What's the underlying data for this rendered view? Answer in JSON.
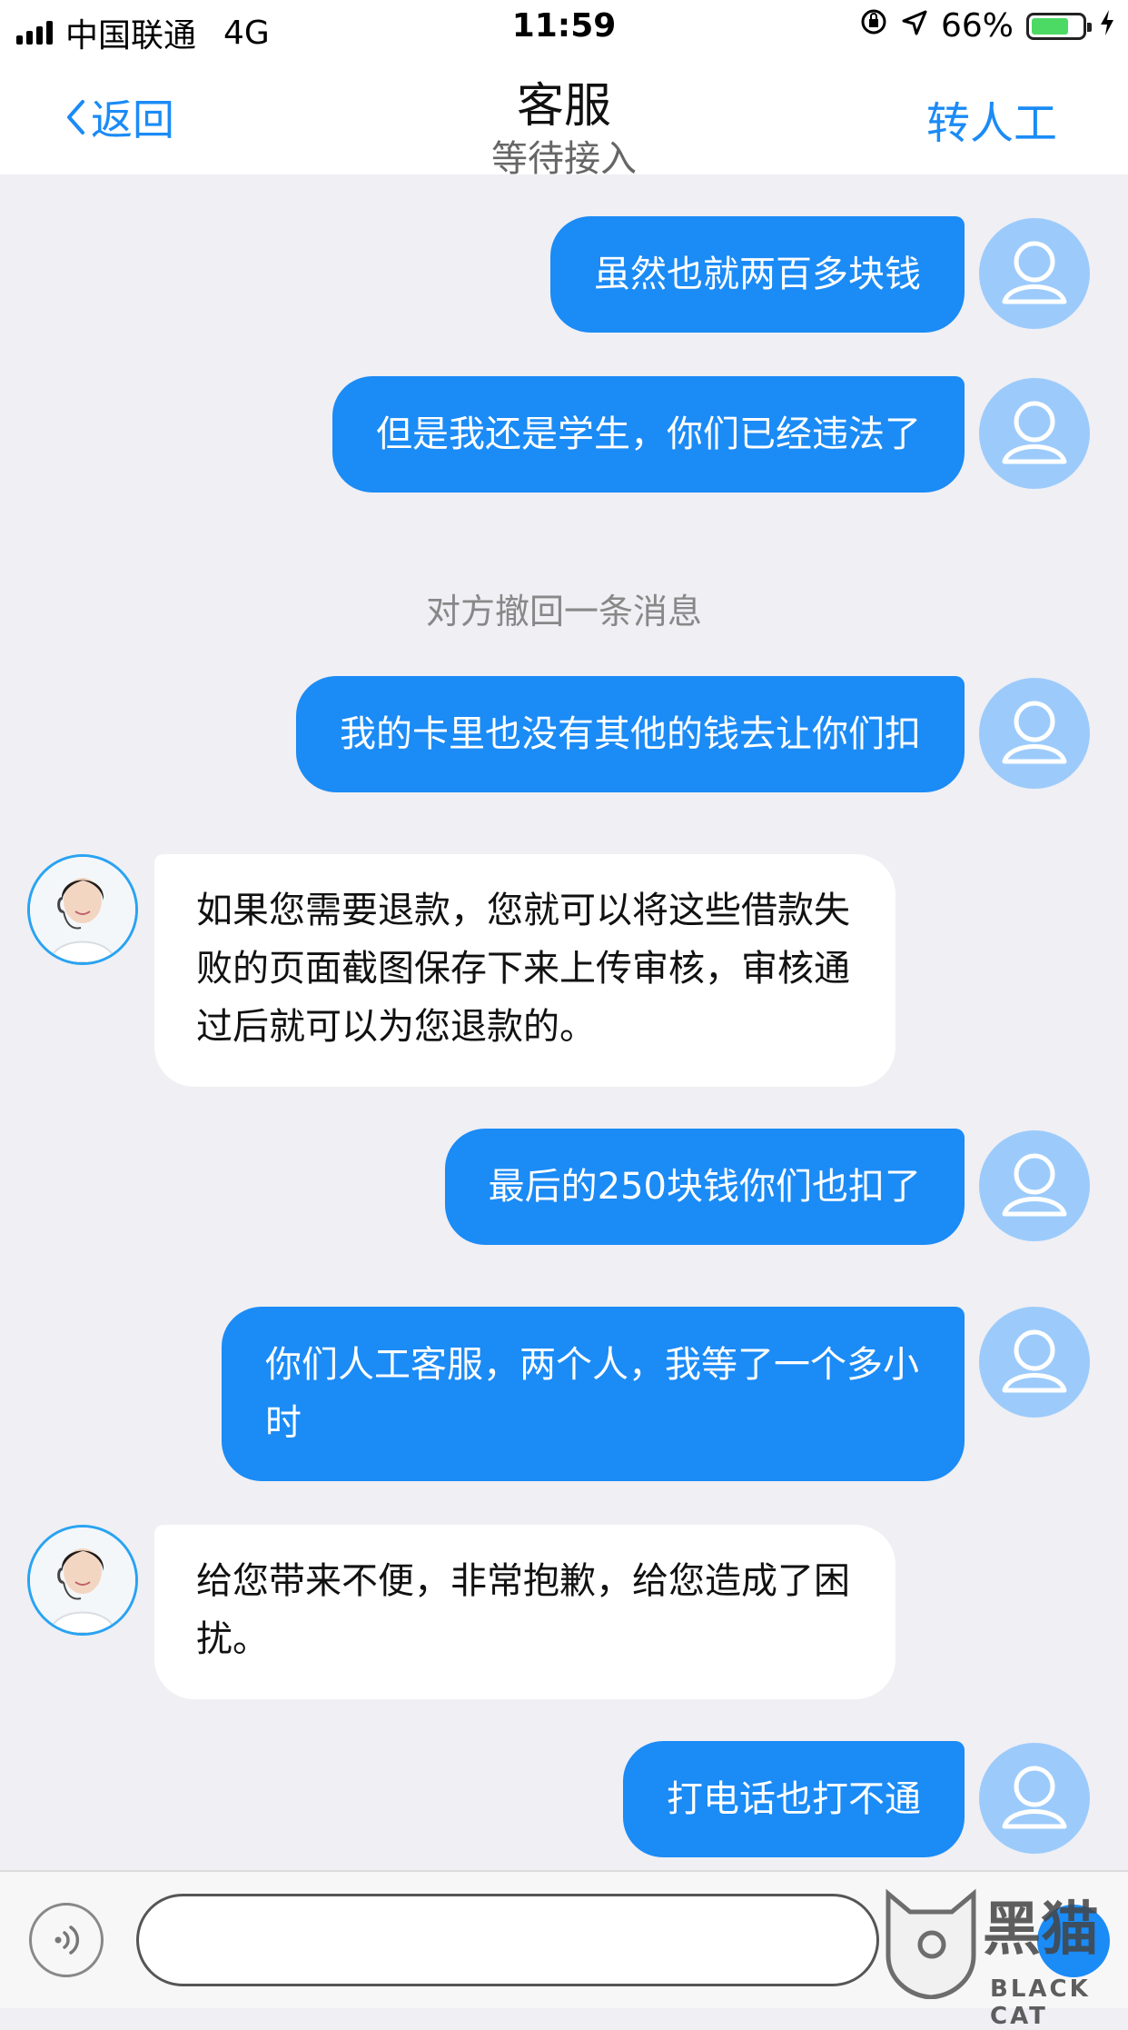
{
  "status_bar": {
    "carrier": "中国联通",
    "network": "4G",
    "time": "11:59",
    "battery": "66%"
  },
  "nav": {
    "back_label": "返回",
    "title": "客服",
    "subtitle": "等待接入",
    "right_action": "转人工"
  },
  "messages": [
    {
      "from": "user",
      "text": "虽然也就两百多块钱"
    },
    {
      "from": "user",
      "text": "但是我还是学生，你们已经违法了"
    },
    {
      "from": "system",
      "text": "对方撤回一条消息"
    },
    {
      "from": "user",
      "text": "我的卡里也没有其他的钱去让你们扣"
    },
    {
      "from": "agent",
      "text": "如果您需要退款，您就可以将这些借款失败的页面截图保存下来上传审核，审核通过后就可以为您退款的。"
    },
    {
      "from": "user",
      "text": "最后的250块钱你们也扣了"
    },
    {
      "from": "user",
      "text": "你们人工客服，两个人，我等了一个多小时"
    },
    {
      "from": "agent",
      "text": "给您带来不便，非常抱歉，给您造成了困扰。"
    },
    {
      "from": "user",
      "text": "打电话也打不通"
    }
  ],
  "input": {
    "value": "",
    "placeholder": ""
  },
  "watermark": {
    "line1": "黑猫",
    "line2": "BLACK CAT"
  },
  "colors": {
    "accent": "#1b8bf6",
    "user_avatar": "#9ccbfb",
    "background": "#efeff4"
  }
}
